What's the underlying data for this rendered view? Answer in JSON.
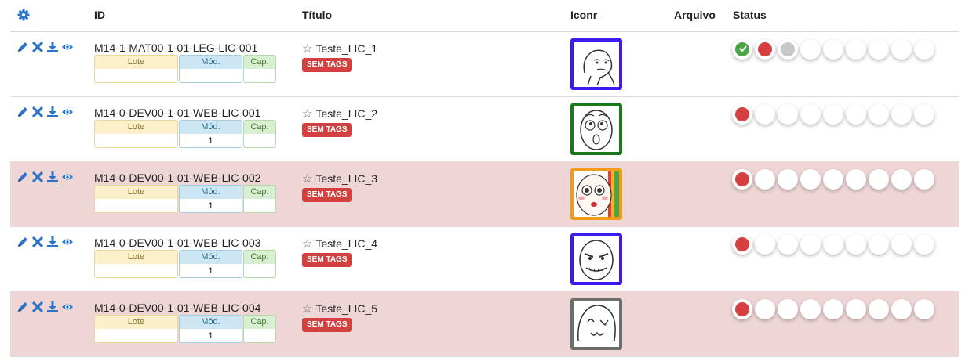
{
  "header": {
    "id": "ID",
    "titulo": "Título",
    "iconr": "Iconr",
    "arquivo": "Arquivo",
    "status": "Status"
  },
  "mini_labels": {
    "lote": "Lote",
    "mod": "Mód.",
    "cap": "Cap."
  },
  "rows": [
    {
      "id": "M14-1-MAT00-1-01-LEG-LIC-001",
      "title": "Teste_LIC_1",
      "tag": "SEM TAGS",
      "lote": "",
      "mod": "",
      "cap": "",
      "highlight": false,
      "icon_border": "#3b1cf0",
      "status": [
        "green-check",
        "red",
        "gray",
        "empty",
        "empty",
        "empty",
        "empty",
        "empty",
        "empty"
      ]
    },
    {
      "id": "M14-0-DEV00-1-01-WEB-LIC-001",
      "title": "Teste_LIC_2",
      "tag": "SEM TAGS",
      "lote": "",
      "mod": "1",
      "cap": "",
      "highlight": false,
      "icon_border": "#1a7a1a",
      "status": [
        "red",
        "empty",
        "empty",
        "empty",
        "empty",
        "empty",
        "empty",
        "empty",
        "empty"
      ]
    },
    {
      "id": "M14-0-DEV00-1-01-WEB-LIC-002",
      "title": "Teste_LIC_3",
      "tag": "SEM TAGS",
      "lote": "",
      "mod": "1",
      "cap": "",
      "highlight": true,
      "icon_border": "#f29a1a",
      "status": [
        "red",
        "empty",
        "empty",
        "empty",
        "empty",
        "empty",
        "empty",
        "empty",
        "empty"
      ]
    },
    {
      "id": "M14-0-DEV00-1-01-WEB-LIC-003",
      "title": "Teste_LIC_4",
      "tag": "SEM TAGS",
      "lote": "",
      "mod": "1",
      "cap": "",
      "highlight": false,
      "icon_border": "#3b1cf0",
      "status": [
        "red",
        "empty",
        "empty",
        "empty",
        "empty",
        "empty",
        "empty",
        "empty",
        "empty"
      ]
    },
    {
      "id": "M14-0-DEV00-1-01-WEB-LIC-004",
      "title": "Teste_LIC_5",
      "tag": "SEM TAGS",
      "lote": "",
      "mod": "1",
      "cap": "",
      "highlight": true,
      "icon_border": "#6e6e6e",
      "status": [
        "red",
        "empty",
        "empty",
        "empty",
        "empty",
        "empty",
        "empty",
        "empty",
        "empty"
      ]
    }
  ],
  "icons": {
    "gear": "gear-icon",
    "edit": "pencil-icon",
    "delete": "close-icon",
    "download": "download-icon",
    "view": "eye-icon",
    "star": "star-icon"
  },
  "colors": {
    "accent": "#2d73c6",
    "tag_red": "#d43f3f",
    "status_green": "#4aa547",
    "highlight_row": "#efd6d6"
  }
}
